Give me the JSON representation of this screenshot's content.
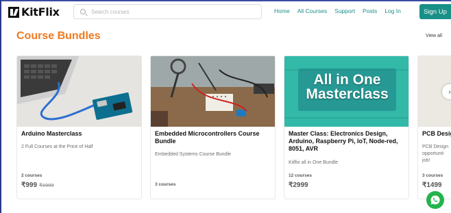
{
  "header": {
    "logo_text": "KitFlix",
    "search_placeholder": "Search courses",
    "nav": [
      "Home",
      "All Courses",
      "Support",
      "Posts",
      "Log In"
    ],
    "signup_label": "Sign Up"
  },
  "section": {
    "title": "Course Bundles",
    "view_all": "View all"
  },
  "cards": [
    {
      "title": "Arduino Masterclass",
      "description": "2 Full Courses at the Price of Half",
      "count": "2 courses",
      "price": "₹999",
      "old_price": "₹1999"
    },
    {
      "title": "Embedded Microcontrollers Course Bundle",
      "description": "Embedded Systems Course Bundle",
      "count": "3 courses",
      "price": "",
      "old_price": ""
    },
    {
      "title": "Master Class: Electronics Design, Arduino, Raspberry Pi, IoT, Node-red, 8051, AVR",
      "thumb_text_line1": "All in One",
      "thumb_text_line2": "Masterclass",
      "description": "Kitflix all in One Bundle",
      "count": "12 courses",
      "price": "₹2999",
      "old_price": ""
    },
    {
      "title": "PCB Desig",
      "description_lines": [
        "PCB Design",
        "opportunit",
        "job!"
      ],
      "count": "3 courses",
      "price": "₹1499",
      "old_price": ""
    }
  ],
  "colors": {
    "accent_teal": "#188f87",
    "section_orange": "#f07a1e",
    "whatsapp_green": "#25b34c"
  },
  "icons": [
    "search-icon",
    "chevron-right-icon",
    "whatsapp-icon"
  ]
}
